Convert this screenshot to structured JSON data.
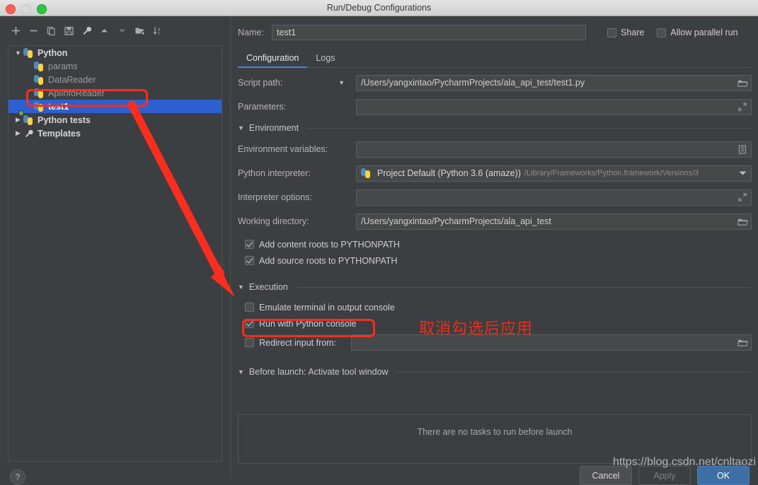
{
  "window": {
    "title": "Run/Debug Configurations",
    "traffic_lights": [
      "close-light",
      "minimize-light",
      "maximize-light"
    ]
  },
  "toolbar": {
    "buttons": [
      {
        "name": "add-button",
        "icon": "plus-icon"
      },
      {
        "name": "remove-button",
        "icon": "minus-icon"
      },
      {
        "name": "copy-button",
        "icon": "copy-icon"
      },
      {
        "name": "save-button",
        "icon": "save-icon"
      },
      {
        "name": "edit-templates-button",
        "icon": "wrench-icon"
      },
      {
        "name": "move-up-button",
        "icon": "arrow-up-icon"
      },
      {
        "name": "move-down-button",
        "icon": "arrow-down-icon"
      },
      {
        "name": "new-folder-button",
        "icon": "new-folder-icon"
      },
      {
        "name": "sort-button",
        "icon": "sort-az-icon"
      }
    ]
  },
  "tree": {
    "items": [
      {
        "label": "Python",
        "icon": "python-icon",
        "expanded": true,
        "bold": true,
        "level": 0,
        "selected": false
      },
      {
        "label": "params",
        "icon": "python-icon",
        "expanded": null,
        "bold": false,
        "level": 1,
        "selected": false
      },
      {
        "label": "DataReader",
        "icon": "python-icon",
        "expanded": null,
        "bold": false,
        "level": 1,
        "selected": false
      },
      {
        "label": "ApiInfoReader",
        "icon": "python-icon",
        "expanded": null,
        "bold": false,
        "level": 1,
        "selected": false
      },
      {
        "label": "test1",
        "icon": "python-icon",
        "expanded": null,
        "bold": true,
        "level": 1,
        "selected": true
      },
      {
        "label": "Python tests",
        "icon": "python-tests-icon",
        "expanded": false,
        "bold": true,
        "level": 0,
        "selected": false
      },
      {
        "label": "Templates",
        "icon": "wrench-icon",
        "expanded": false,
        "bold": true,
        "level": 0,
        "selected": false
      }
    ]
  },
  "help": {
    "label": "?"
  },
  "name_row": {
    "label": "Name:",
    "value": "test1",
    "share": {
      "label": "Share",
      "checked": false
    },
    "parallel": {
      "label": "Allow parallel run",
      "checked": false
    }
  },
  "tabs": [
    {
      "label": "Configuration",
      "active": true
    },
    {
      "label": "Logs",
      "active": false
    }
  ],
  "fields": {
    "script_path": {
      "label": "Script path:",
      "value": "/Users/yangxintao/PycharmProjects/ala_api_test/test1.py",
      "end_icon": "folder-icon"
    },
    "parameters": {
      "label": "Parameters:",
      "value": "",
      "end_icon": "expand-icon"
    },
    "environment_variables": {
      "label": "Environment variables:",
      "value": "",
      "end_icon": "list-icon"
    },
    "python_interpreter": {
      "label": "Python interpreter:",
      "value_main": "Project Default (Python 3.6 (amaze))",
      "value_path": "/Library/Frameworks/Python.framework/Versions/3",
      "end_icon": "chevron-down-icon"
    },
    "interpreter_options": {
      "label": "Interpreter options:",
      "value": "",
      "end_icon": "expand-icon"
    },
    "working_directory": {
      "label": "Working directory:",
      "value": "/Users/yangxintao/PycharmProjects/ala_api_test",
      "end_icon": "folder-icon"
    },
    "redirect_input": {
      "label": "Redirect input from:",
      "value": "",
      "checked": false,
      "end_icon": "folder-icon"
    }
  },
  "sections": {
    "environment": {
      "title": "Environment",
      "expanded": true
    },
    "execution": {
      "title": "Execution",
      "expanded": true
    },
    "before_launch": {
      "title": "Before launch: Activate tool window",
      "expanded": true,
      "empty_message": "There are no tasks to run before launch"
    }
  },
  "checkboxes": {
    "add_content_roots": {
      "label": "Add content roots to PYTHONPATH",
      "checked": true
    },
    "add_source_roots": {
      "label": "Add source roots to PYTHONPATH",
      "checked": true
    },
    "emulate_terminal": {
      "label": "Emulate terminal in output console",
      "checked": false
    },
    "run_with_console": {
      "label": "Run with Python console",
      "checked": true
    }
  },
  "buttons": {
    "cancel": "Cancel",
    "apply": "Apply",
    "ok": "OK"
  },
  "annotations": {
    "chinese_note": "取消勾选后应用",
    "highlight_color": "#fc2d1c",
    "watermark": "https://blog.csdn.net/cnltaozi"
  }
}
